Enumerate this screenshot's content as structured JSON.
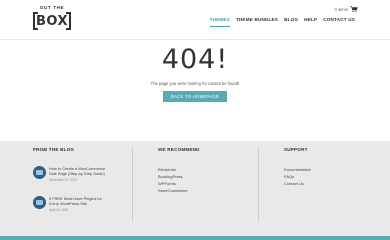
{
  "header": {
    "logo_top": "OUT THE",
    "logo_main": "BOX",
    "cart_text": "0 items",
    "nav": [
      {
        "label": "THEMES",
        "active": true
      },
      {
        "label": "THEME BUNDLES",
        "active": false
      },
      {
        "label": "BLOG",
        "active": false
      },
      {
        "label": "HELP",
        "active": false
      },
      {
        "label": "CONTACT US",
        "active": false
      }
    ]
  },
  "main": {
    "error_code": "404!",
    "message": "The page you were looking for cannot be found!",
    "button_label": "BACK TO HOMEPAGE"
  },
  "footer": {
    "blog": {
      "title": "FROM THE BLOG",
      "posts": [
        {
          "title": "How to Create a WooCommerce Sale Page (Step-by-Step Guide)",
          "date": "December 21, 2021"
        },
        {
          "title": "5 FREE Must-Have Plugins for Every WordPress Site",
          "date": "April 14, 2021"
        }
      ]
    },
    "recommend": {
      "title": "WE RECOMMEND",
      "links": [
        "Elementor",
        "BookingPress",
        "WPForms",
        "StoreCustomizer"
      ]
    },
    "support": {
      "title": "SUPPORT",
      "links": [
        "Documentation",
        "FAQs",
        "Contact Us"
      ]
    }
  },
  "colors": {
    "accent": "#5ba9b2",
    "footer_bg": "#e9e9e9",
    "text": "#333333"
  }
}
